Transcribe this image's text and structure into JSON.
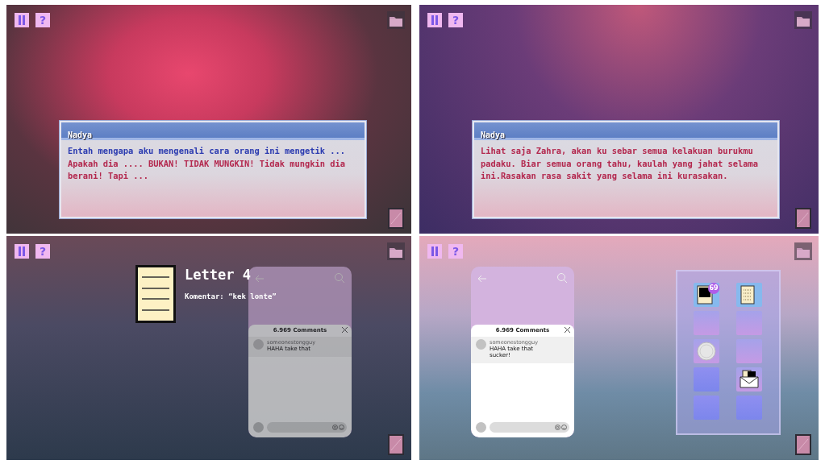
{
  "panels": [
    {
      "hud": {
        "help_label": "?"
      },
      "dialogue": {
        "speaker": "Nadya",
        "lines": [
          {
            "text": "Entah mengapa aku mengenali cara orang ini mengetik ...",
            "color": "#2b3bb0"
          },
          {
            "text": "Apakah dia .... BUKAN! TIDAK MUNGKIN! Tidak mungkin dia berani! Tapi ...",
            "color": "#b3284e"
          }
        ]
      }
    },
    {
      "hud": {
        "help_label": "?"
      },
      "dialogue": {
        "speaker": "Nadya",
        "lines": [
          {
            "text": "Lihat saja Zahra, akan ku sebar semua kelakuan burukmu padaku. Biar semua orang tahu, kaulah yang jahat selama ini.Rasakan rasa sakit yang selama ini kurasakan.",
            "color": "#b3284e"
          }
        ]
      }
    },
    {
      "hud": {
        "help_label": "?"
      },
      "phone": {
        "dimmed": true,
        "comments_count": "6.969 Comments",
        "comments": [
          {
            "user": "someonestongguy",
            "text": "HAHA take that"
          }
        ]
      },
      "letter_popup": {
        "title": "Letter 4",
        "comment": "Komentar: “kek lonte”"
      }
    },
    {
      "hud": {
        "help_label": "?"
      },
      "phone": {
        "dimmed": false,
        "comments_count": "6.969 Comments",
        "comments": [
          {
            "user": "someonestongguy",
            "text": "HAHA take that sucker!"
          }
        ]
      },
      "inventory": {
        "slots": [
          {
            "kind": "photo",
            "badge": "69"
          },
          {
            "kind": "note"
          },
          {
            "kind": "empty"
          },
          {
            "kind": "empty"
          },
          {
            "kind": "disc"
          },
          {
            "kind": "empty"
          },
          {
            "kind": "empty"
          },
          {
            "kind": "envelope"
          },
          {
            "kind": "empty"
          },
          {
            "kind": "empty"
          }
        ]
      }
    }
  ]
}
